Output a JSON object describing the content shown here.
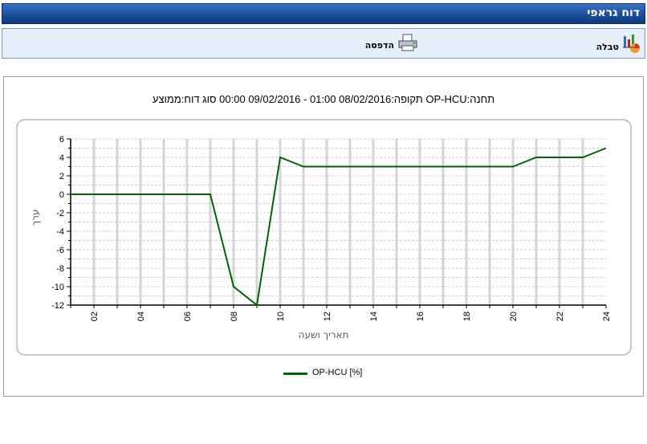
{
  "window": {
    "title": "דוח גראפי"
  },
  "toolbar": {
    "table_label": "טבלה",
    "print_label": "הדפסה"
  },
  "chart_data": {
    "type": "line",
    "title": "תקופה:08/02/2016 01:00 - 09/02/2016 00:00 סוג  דוח:ממוצע OP-HCU:תחנה",
    "xlabel": "תאריך ושעה",
    "ylabel": "ערך",
    "x_tick_labels": [
      "02",
      "04",
      "06",
      "08",
      "10",
      "12",
      "14",
      "16",
      "18",
      "20",
      "22",
      "24"
    ],
    "xlim": [
      1,
      24
    ],
    "ylim": [
      -12,
      6
    ],
    "y_ticks": [
      -12,
      -10,
      -8,
      -6,
      -4,
      -2,
      0,
      2,
      4,
      6
    ],
    "grid": true,
    "legend_position": "bottom",
    "series": [
      {
        "name": "OP-HCU [%]",
        "color": "#006400",
        "x": [
          1,
          2,
          3,
          4,
          5,
          6,
          7,
          8,
          9,
          10,
          11,
          12,
          13,
          14,
          15,
          16,
          17,
          18,
          19,
          20,
          21,
          22,
          23,
          24
        ],
        "y": [
          0,
          0,
          0,
          0,
          0,
          0,
          0,
          -10,
          -12,
          4,
          3,
          3,
          3,
          3,
          3,
          3,
          3,
          3,
          3,
          3,
          4,
          4,
          4,
          5
        ]
      }
    ]
  }
}
